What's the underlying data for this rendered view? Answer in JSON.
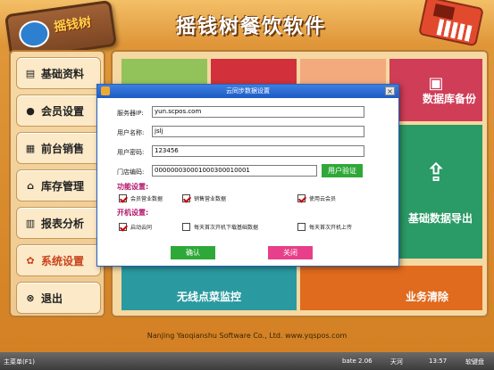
{
  "header": {
    "title": "摇钱树餐饮软件",
    "logo_text": "摇钱树"
  },
  "sidebar": {
    "items": [
      {
        "label": "基础资料",
        "icon": "document-icon"
      },
      {
        "label": "会员设置",
        "icon": "user-icon"
      },
      {
        "label": "前台销售",
        "icon": "printer-icon"
      },
      {
        "label": "库存管理",
        "icon": "home-icon"
      },
      {
        "label": "报表分析",
        "icon": "report-icon"
      },
      {
        "label": "系统设置",
        "icon": "gear-icon"
      },
      {
        "label": "退出",
        "icon": "exit-icon"
      }
    ]
  },
  "tiles": {
    "db_backup": "数据库备份",
    "export": "基础数据导出",
    "wireless": "无线点菜监控",
    "clear": "业务清除"
  },
  "footer": {
    "company": "Nanjing Yaoqianshu Software Co., Ltd. www.yqspos.com"
  },
  "statusbar": {
    "menu": "主菜单(F1)",
    "version": "bate 2.06",
    "weather": "天河",
    "time": "13:57",
    "app": "软键盘"
  },
  "dialog": {
    "title": "云同步数据设置",
    "server_label": "服务器IP:",
    "server_value": "yun.scpos.com",
    "user_label": "用户名称:",
    "user_value": "jslj",
    "pass_label": "用户密码:",
    "pass_value": "123456",
    "store_label": "门店编码:",
    "store_value": "000000030001000300010001",
    "verify_button": "用户验证",
    "features_title": "功能设置:",
    "opt_member": "会员营业数据",
    "opt_sales": "销售营业数据",
    "opt_cloud_member": "使用云会员",
    "startup_title": "开机设置:",
    "opt_auto": "启动云同",
    "opt_download": "每天首次开机下载基础数据",
    "opt_upload": "每天首次开机上传",
    "confirm_button": "确认",
    "close_button": "关闭"
  }
}
